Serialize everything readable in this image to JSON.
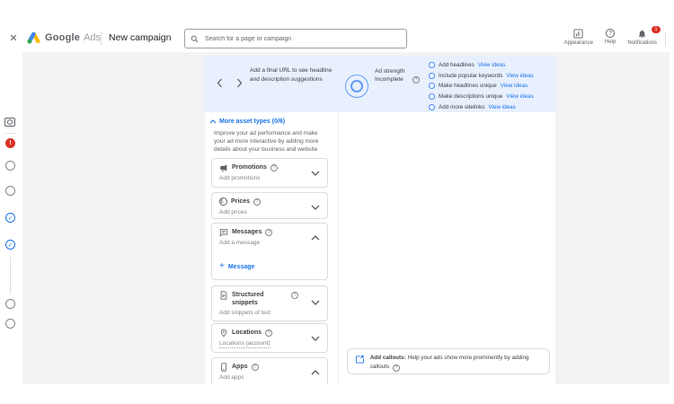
{
  "colors": {
    "accent_blue": "#1a73e8",
    "gauge_blue": "#669df6",
    "error_red": "#d93025",
    "panel_blue_bg": "#e8f0fe",
    "canvas_grey": "#f1f3f4",
    "border_grey": "#dadce0",
    "logo_blue": "#4285f4",
    "logo_yellow": "#fbbc04",
    "logo_green": "#34a853"
  },
  "glyphs": {
    "close": "✕",
    "question": "?",
    "error": "!",
    "check": "✓",
    "plus": "+",
    "dollar": "$"
  },
  "app_bar": {
    "brand_name": "Google",
    "brand_suffix": "Ads",
    "page_title": "New campaign",
    "search": {
      "placeholder": "Search for a page or campaign"
    },
    "actions": {
      "appearance": "Appearance",
      "help": "Help",
      "notifications": "Notifications",
      "notifications_badge": "1"
    }
  },
  "sidebar": {
    "steps": [
      {
        "icon": "ad-preview",
        "state": "default"
      },
      {
        "icon": "step",
        "state": "error"
      },
      {
        "icon": "step",
        "state": "empty"
      },
      {
        "icon": "step",
        "state": "empty"
      },
      {
        "icon": "step",
        "state": "complete"
      },
      {
        "icon": "step",
        "state": "complete"
      },
      {
        "icon": "step",
        "state": "empty"
      },
      {
        "icon": "step",
        "state": "empty"
      }
    ]
  },
  "strength_panel": {
    "suggestion": "Add a final URL to see headline and description suggestions",
    "gauge_label": "Ad strength",
    "gauge_status": "Incomplete",
    "ideas": [
      {
        "label": "Add headlines",
        "link": "View ideas"
      },
      {
        "label": "Include popular keywords",
        "link": "View ideas"
      },
      {
        "label": "Make headlines unique",
        "link": "View ideas"
      },
      {
        "label": "Make descriptions unique",
        "link": "View ideas"
      },
      {
        "label": "Add more sitelinks",
        "link": "View ideas"
      }
    ]
  },
  "assets": {
    "section_title": "More asset types (0/6)",
    "description": "Improve your ad performance and make your ad more interactive by adding more details about your business and website",
    "cards": [
      {
        "label": "Promotions",
        "hint": "Add promotions",
        "expanded": false
      },
      {
        "label": "Prices",
        "hint": "Add prices",
        "expanded": false
      },
      {
        "label": "Messages",
        "hint": "Add a message",
        "action_label": "Message",
        "expanded": true
      },
      {
        "label": "Structured snippets",
        "hint": "Add snippets of text",
        "expanded": false
      },
      {
        "label": "Locations",
        "hint": "Locations (account)",
        "expanded": false
      },
      {
        "label": "Apps",
        "hint": "Add apps",
        "expanded": true
      }
    ]
  },
  "callout_banner": {
    "lead": "Add callouts:",
    "body": "Help your ads show more prominently by adding callouts"
  }
}
